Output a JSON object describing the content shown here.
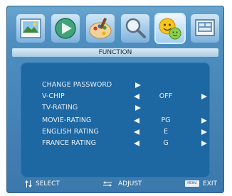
{
  "menu": {
    "title": "FUNCTION",
    "tabs": [
      {
        "icon": "picture-icon"
      },
      {
        "icon": "sound-icon"
      },
      {
        "icon": "color-palette-icon"
      },
      {
        "icon": "search-icon"
      },
      {
        "icon": "function-smiley-icon",
        "selected": true
      },
      {
        "icon": "info-screen-icon"
      }
    ],
    "items": [
      {
        "label": "CHANGE PASSWORD",
        "value": "",
        "arrows": "enter"
      },
      {
        "label": "V-CHIP",
        "value": "OFF",
        "arrows": "both"
      },
      {
        "label": "TV-RATING",
        "value": "",
        "arrows": "enter"
      },
      {
        "label": "MOVIE-RATING",
        "value": "PG",
        "arrows": "both"
      },
      {
        "label": "ENGLISH RATING",
        "value": "E",
        "arrows": "both"
      },
      {
        "label": "FRANCE RATING",
        "value": "G",
        "arrows": "both"
      }
    ]
  },
  "footer": {
    "select_label": "SELECT",
    "adjust_label": "ADJUST",
    "menu_key": "MENU",
    "exit_label": "EXIT"
  },
  "colors": {
    "frame": "#4f8fc0",
    "panel": "#1d67a3",
    "text": "#e6eef6"
  }
}
